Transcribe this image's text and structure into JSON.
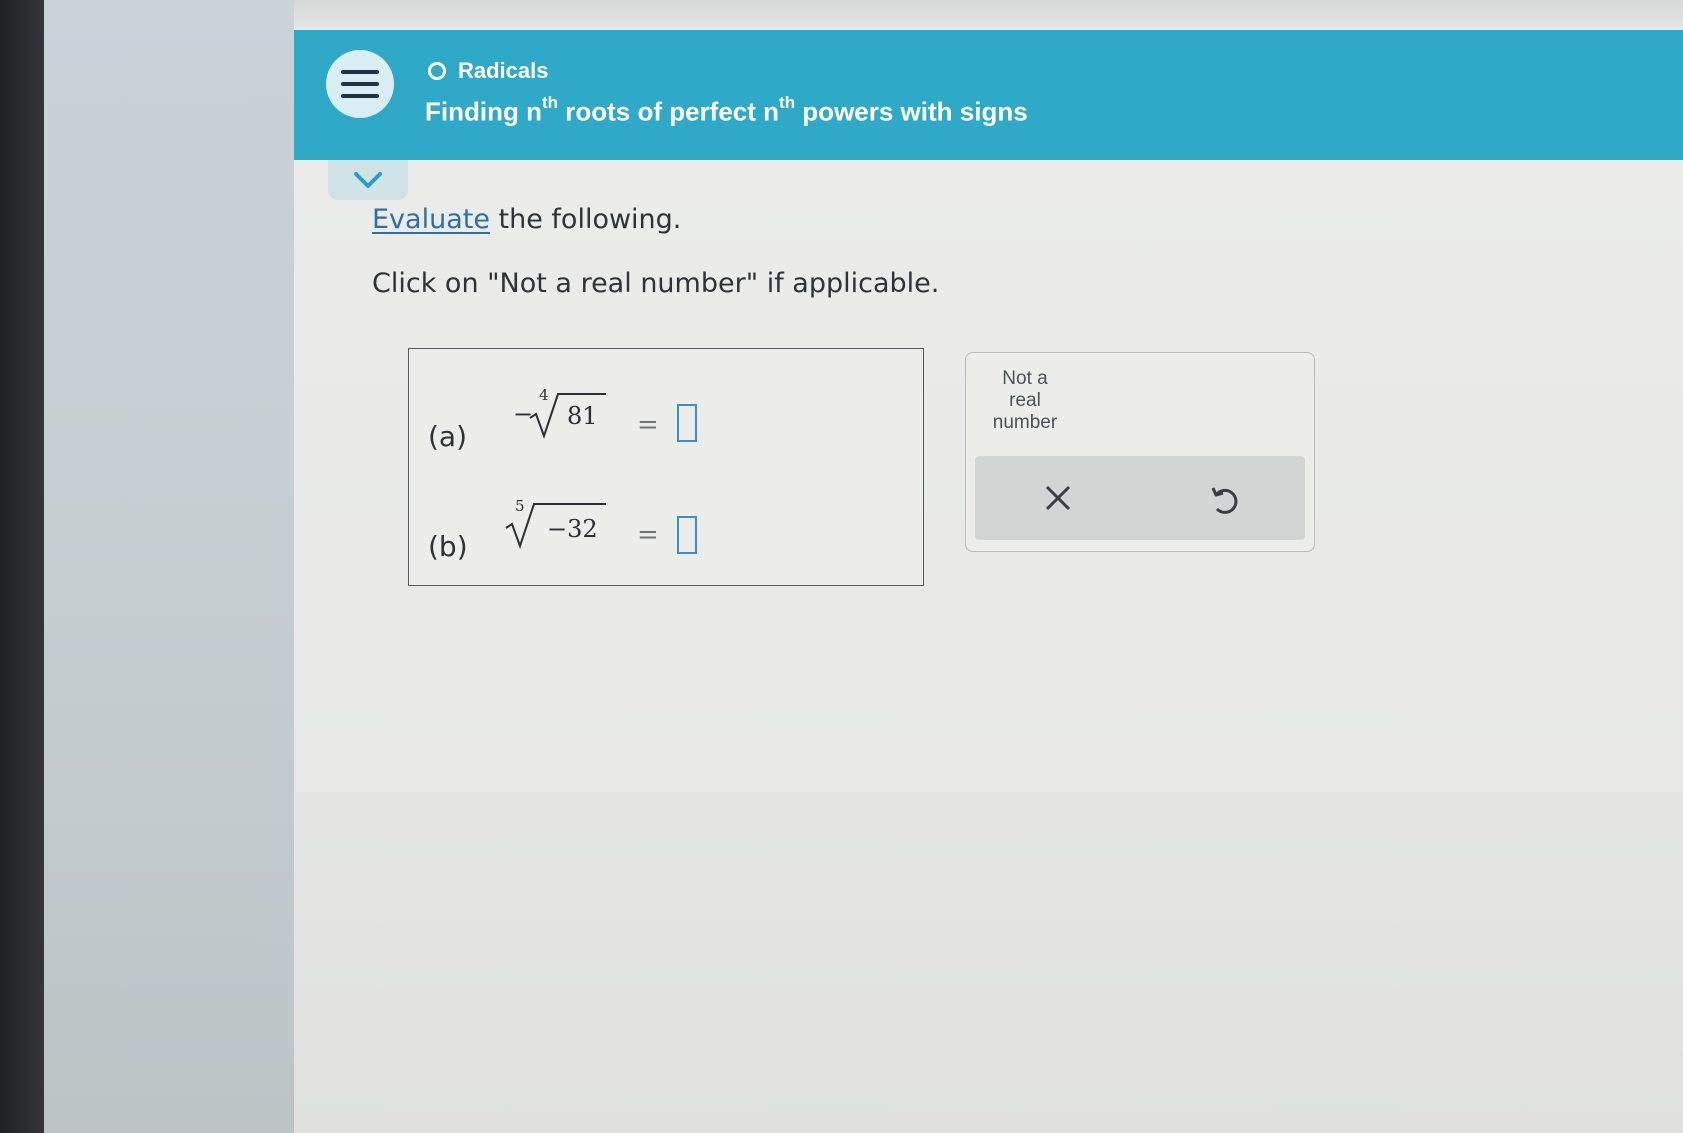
{
  "header": {
    "breadcrumb": "Radicals",
    "title_parts": [
      "Finding n",
      "th",
      " roots of perfect n",
      "th",
      " powers with signs"
    ],
    "menu_icon": "hamburger-icon",
    "color": "#2eaac8"
  },
  "instructions": {
    "link": "Evaluate",
    "line1_rest": " the following.",
    "line2": "Click on \"Not a real number\" if applicable."
  },
  "problems": [
    {
      "label": "(a)",
      "sign": "−",
      "index": "4",
      "radicand": "81",
      "equals": "=",
      "answer": ""
    },
    {
      "label": "(b)",
      "sign": "",
      "index": "5",
      "radicand": "−32",
      "equals": "=",
      "answer": ""
    }
  ],
  "keypad": {
    "not_real_label": "Not a real number",
    "clear_icon": "close-icon",
    "undo_icon": "undo-icon"
  },
  "colors": {
    "accent": "#3a90c0",
    "link": "#2f6fa8"
  }
}
